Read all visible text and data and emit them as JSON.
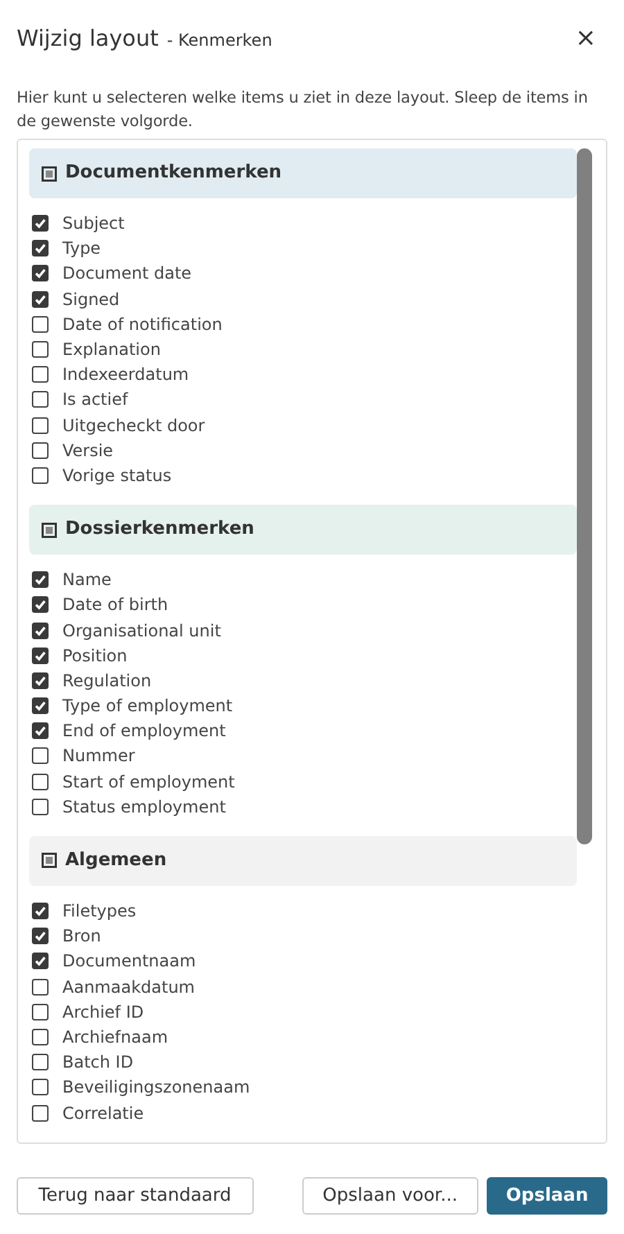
{
  "dialog": {
    "title": "Wijzig layout",
    "subtitle": "- Kenmerken",
    "close": "×"
  },
  "description": "Hier kunt u selecteren welke items u ziet in deze layout. Sleep de items in de gewenste volgorde.",
  "groups": [
    {
      "title": "Documentkenmerken",
      "color": "#e0ecf1",
      "items": [
        {
          "label": "Subject",
          "checked": true
        },
        {
          "label": "Type",
          "checked": true
        },
        {
          "label": "Document date",
          "checked": true
        },
        {
          "label": "Signed",
          "checked": true
        },
        {
          "label": "Date of notification",
          "checked": false
        },
        {
          "label": "Explanation",
          "checked": false
        },
        {
          "label": "Indexeerdatum",
          "checked": false
        },
        {
          "label": "Is actief",
          "checked": false
        },
        {
          "label": "Uitgecheckt door",
          "checked": false
        },
        {
          "label": "Versie",
          "checked": false
        },
        {
          "label": "Vorige status",
          "checked": false
        }
      ]
    },
    {
      "title": "Dossierkenmerken",
      "color": "#e5f1ed",
      "items": [
        {
          "label": "Name",
          "checked": true
        },
        {
          "label": "Date of birth",
          "checked": true
        },
        {
          "label": "Organisational unit",
          "checked": true
        },
        {
          "label": "Position",
          "checked": true
        },
        {
          "label": "Regulation",
          "checked": true
        },
        {
          "label": "Type of employment",
          "checked": true
        },
        {
          "label": "End of employment",
          "checked": true
        },
        {
          "label": "Nummer",
          "checked": false
        },
        {
          "label": "Start of employment",
          "checked": false
        },
        {
          "label": "Status employment",
          "checked": false
        }
      ]
    },
    {
      "title": "Algemeen",
      "color": "#f2f2f2",
      "items": [
        {
          "label": "Filetypes",
          "checked": true
        },
        {
          "label": "Bron",
          "checked": true
        },
        {
          "label": "Documentnaam",
          "checked": true
        },
        {
          "label": "Aanmaakdatum",
          "checked": false
        },
        {
          "label": "Archief ID",
          "checked": false
        },
        {
          "label": "Archiefnaam",
          "checked": false
        },
        {
          "label": "Batch ID",
          "checked": false
        },
        {
          "label": "Beveiligingszonenaam",
          "checked": false
        },
        {
          "label": "Correlatie",
          "checked": false
        }
      ]
    }
  ],
  "buttons": [
    {
      "label": "Terug naar standaard",
      "kind": "secondary"
    },
    {
      "label": "Opslaan voor...",
      "kind": "secondary"
    },
    {
      "label": "Opslaan",
      "kind": "primary"
    }
  ]
}
